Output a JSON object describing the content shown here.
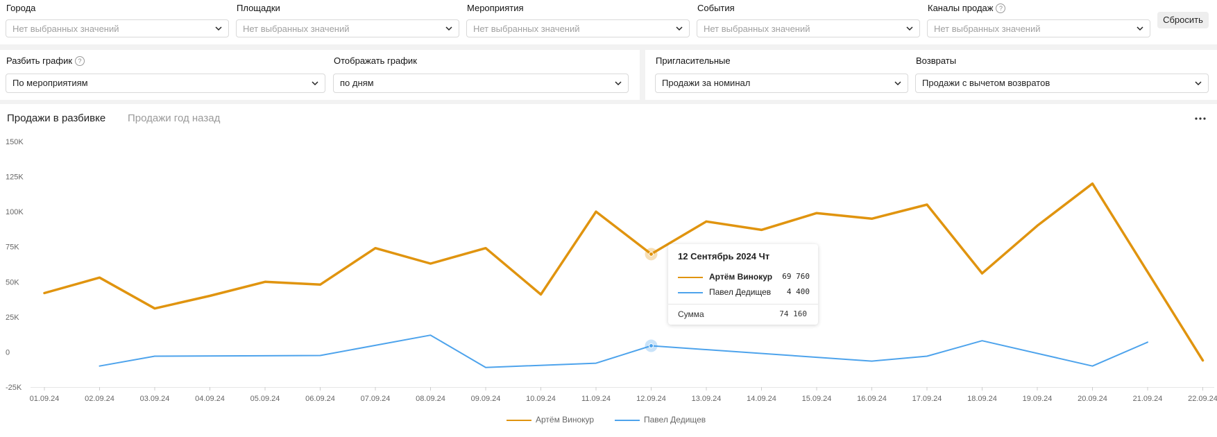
{
  "filters": [
    {
      "label": "Города",
      "placeholder": "Нет выбранных значений"
    },
    {
      "label": "Площадки",
      "placeholder": "Нет выбранных значений"
    },
    {
      "label": "Мероприятия",
      "placeholder": "Нет выбранных значений"
    },
    {
      "label": "События",
      "placeholder": "Нет выбранных значений"
    },
    {
      "label": "Каналы продаж",
      "placeholder": "Нет выбранных значений",
      "help": "?"
    }
  ],
  "reset_label": "Сбросить",
  "options": {
    "split": {
      "label": "Разбить график",
      "help": "?",
      "value": "По мероприятиям"
    },
    "display": {
      "label": "Отображать график",
      "value": "по дням"
    },
    "invites": {
      "label": "Пригласительные",
      "value": "Продажи за номинал"
    },
    "returns": {
      "label": "Возвраты",
      "value": "Продажи с вычетом возвратов"
    }
  },
  "tabs": {
    "active": "Продажи в разбивке",
    "inactive": "Продажи год назад"
  },
  "icons": {
    "more": "more-horizontal-icon",
    "chevron": "chevron-down-icon",
    "help": "question-circle-icon"
  },
  "colors": {
    "series1": "#E0940F",
    "series2": "#4DA3EC",
    "grid": "#e8e8e8"
  },
  "chart_data": {
    "type": "line",
    "x": [
      "01.09.24",
      "02.09.24",
      "03.09.24",
      "04.09.24",
      "05.09.24",
      "06.09.24",
      "07.09.24",
      "08.09.24",
      "09.09.24",
      "10.09.24",
      "11.09.24",
      "12.09.24",
      "13.09.24",
      "14.09.24",
      "15.09.24",
      "16.09.24",
      "17.09.24",
      "18.09.24",
      "19.09.24",
      "20.09.24",
      "21.09.24",
      "22.09.24"
    ],
    "ylim": [
      -25000,
      150000
    ],
    "yticks": [
      -25000,
      0,
      25000,
      50000,
      75000,
      100000,
      125000,
      150000
    ],
    "ytick_labels": [
      "-25K",
      "0",
      "25K",
      "50K",
      "75K",
      "100K",
      "125K",
      "150K"
    ],
    "grid": false,
    "legend_position": "bottom",
    "series": [
      {
        "name": "Артём Винокур",
        "color": "#E0940F",
        "values": [
          42000,
          53000,
          31000,
          40000,
          50000,
          48000,
          74000,
          63000,
          74000,
          41000,
          100000,
          69760,
          93000,
          87000,
          99000,
          95000,
          105000,
          56000,
          90000,
          120000,
          57000,
          -6000
        ]
      },
      {
        "name": "Павел Дедищев",
        "color": "#4DA3EC",
        "values": [
          null,
          -10000,
          -3000,
          null,
          null,
          -2500,
          null,
          12000,
          -11000,
          null,
          -8000,
          4400,
          null,
          null,
          null,
          -6500,
          -3000,
          8000,
          null,
          -10000,
          7000,
          null
        ]
      }
    ],
    "highlight_index": 11,
    "tooltip": {
      "title": "12 Сентябрь 2024 Чт",
      "rows": [
        {
          "name": "Артём Винокур",
          "value": "69 760"
        },
        {
          "name": "Павел Дедищев",
          "value": "4 400"
        }
      ],
      "sum_label": "Сумма",
      "sum_value": "74 160"
    }
  }
}
